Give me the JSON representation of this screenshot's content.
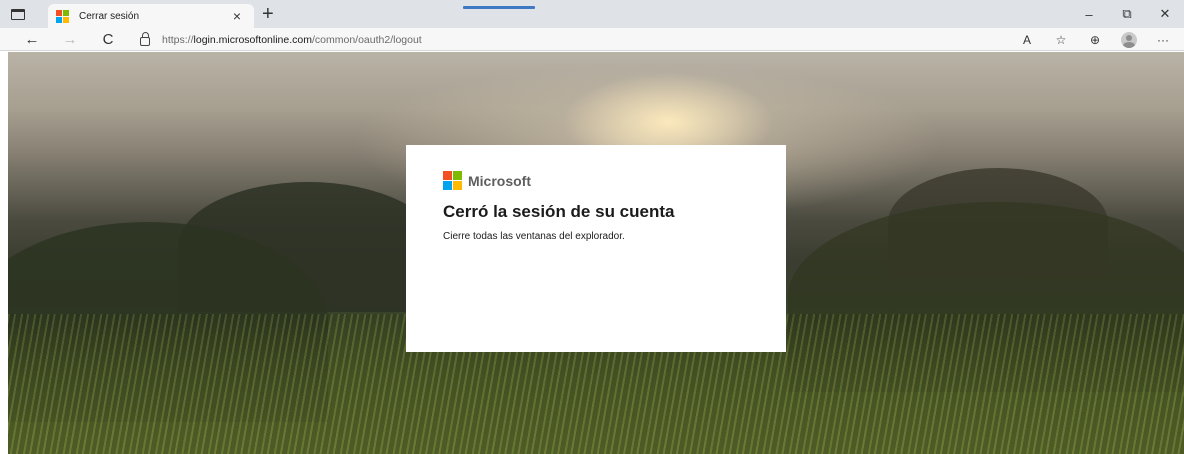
{
  "browser": {
    "tab": {
      "title": "Cerrar sesión",
      "close_glyph": "×"
    },
    "new_tab_glyph": "+",
    "window_controls": {
      "minimize": "–",
      "maximize": "⧉",
      "close": "✕"
    },
    "nav": {
      "back": "←",
      "forward": "→",
      "refresh": "C"
    },
    "url": {
      "prefix": "https://",
      "host": "login.microsoftonline.com",
      "path": "/common/oauth2/logout"
    },
    "toolbar": {
      "read_aloud": "A",
      "favorites": "☆",
      "collections": "⊕",
      "more": "···"
    }
  },
  "logo_colors": [
    "#f25022",
    "#7fba00",
    "#00a4ef",
    "#ffb900"
  ],
  "card": {
    "brand": "Microsoft",
    "title": "Cerró la sesión de su cuenta",
    "description": "Cierre todas las ventanas del explorador."
  }
}
